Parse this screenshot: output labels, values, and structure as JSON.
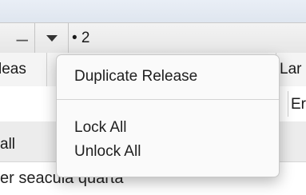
{
  "toolbar": {
    "remove_label": "–",
    "field_value": "• 2"
  },
  "columns": {
    "left_header_fragment": "leas",
    "right_header_fragment": "Lar"
  },
  "rows": {
    "row2_right_fragment": "Er",
    "row3_left_fragment": "all",
    "row4_text": "er seacula quarta"
  },
  "menu": {
    "items": [
      {
        "label": "Duplicate Release"
      },
      {
        "label": "Lock All"
      },
      {
        "label": "Unlock All"
      }
    ]
  }
}
